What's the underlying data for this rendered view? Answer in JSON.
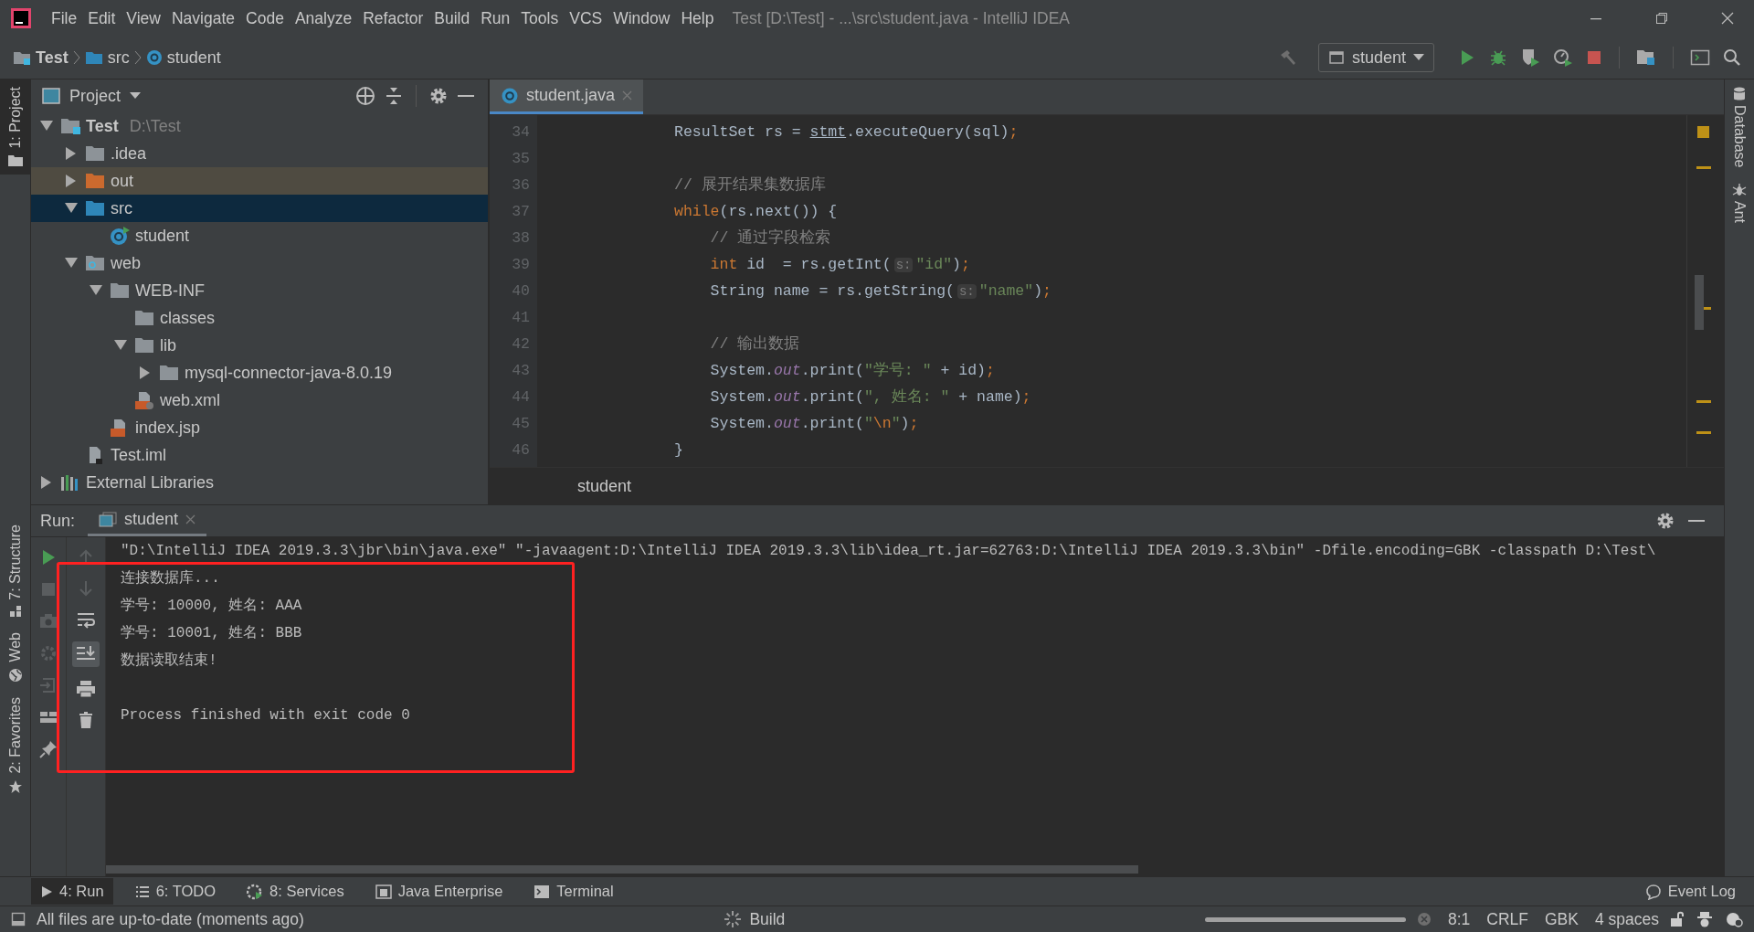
{
  "window": {
    "title": "Test [D:\\Test] - ...\\src\\student.java - IntelliJ IDEA"
  },
  "menu": [
    "File",
    "Edit",
    "View",
    "Navigate",
    "Code",
    "Analyze",
    "Refactor",
    "Build",
    "Run",
    "Tools",
    "VCS",
    "Window",
    "Help"
  ],
  "breadcrumbs": [
    {
      "label": "Test",
      "kind": "project"
    },
    {
      "label": "src",
      "kind": "source"
    },
    {
      "label": "student",
      "kind": "class"
    }
  ],
  "run_config": {
    "label": "student"
  },
  "left_tabs_top": [
    {
      "label": "1: Project",
      "selected": true
    }
  ],
  "left_tabs_bottom": [
    {
      "label": "7: Structure",
      "selected": false,
      "kind": "structure"
    },
    {
      "label": "Web",
      "selected": false,
      "kind": "web"
    },
    {
      "label": "2: Favorites",
      "selected": false,
      "kind": "favorites"
    }
  ],
  "project_panel": {
    "title": "Project",
    "tree": [
      {
        "label": "Test",
        "path": "D:\\Test",
        "kind": "project",
        "expanded": true,
        "selected": false,
        "children": [
          {
            "label": ".idea",
            "kind": "folder",
            "expanded": false,
            "selected": false
          },
          {
            "label": "out",
            "kind": "excluded",
            "expanded": false,
            "selected": false
          },
          {
            "label": "src",
            "kind": "source",
            "expanded": true,
            "selected": true,
            "children": [
              {
                "label": "student",
                "kind": "class",
                "selected": false
              }
            ]
          },
          {
            "label": "web",
            "kind": "web",
            "expanded": true,
            "selected": false,
            "children": [
              {
                "label": "WEB-INF",
                "kind": "folder",
                "expanded": true,
                "selected": false,
                "children": [
                  {
                    "label": "classes",
                    "kind": "folder",
                    "selected": false
                  },
                  {
                    "label": "lib",
                    "kind": "folder",
                    "expanded": true,
                    "selected": false,
                    "children": [
                      {
                        "label": "mysql-connector-java-8.0.19",
                        "kind": "folder",
                        "expanded": false,
                        "selected": false
                      }
                    ]
                  },
                  {
                    "label": "web.xml",
                    "kind": "xml",
                    "selected": false
                  }
                ]
              },
              {
                "label": "index.jsp",
                "kind": "jsp",
                "selected": false
              }
            ]
          },
          {
            "label": "Test.iml",
            "kind": "iml",
            "selected": false
          }
        ]
      },
      {
        "label": "External Libraries",
        "kind": "libraries",
        "expanded": false,
        "selected": false
      }
    ]
  },
  "editor": {
    "tabs": [
      {
        "label": "student.java",
        "selected": true
      }
    ],
    "lines": [
      {
        "number": "34",
        "tokens": [
          {
            "kind": "plain",
            "text": "ResultSet rs = "
          },
          {
            "kind": "underline",
            "text": "stmt"
          },
          {
            "kind": "plain",
            "text": ".executeQuery(sql)"
          },
          {
            "kind": "keyword",
            "text": ";"
          }
        ]
      },
      {
        "number": "35"
      },
      {
        "number": "36",
        "tokens": [
          {
            "kind": "comment",
            "text": "// 展开结果集数据库"
          }
        ]
      },
      {
        "number": "37",
        "tokens": [
          {
            "kind": "keyword",
            "text": "while"
          },
          {
            "kind": "plain",
            "text": "(rs.next()) {"
          }
        ]
      },
      {
        "number": "38",
        "tokens": [
          {
            "kind": "comment",
            "text": "    // 通过字段检索"
          }
        ]
      },
      {
        "number": "39",
        "tokens": [
          {
            "kind": "keyword",
            "text": "    int"
          },
          {
            "kind": "plain",
            "text": " id  = rs.getInt("
          },
          {
            "kind": "hint",
            "text": "s:"
          },
          {
            "kind": "string",
            "text": "\"id\""
          },
          {
            "kind": "plain",
            "text": ")"
          },
          {
            "kind": "keyword",
            "text": ";"
          }
        ]
      },
      {
        "number": "40",
        "tokens": [
          {
            "kind": "plain",
            "text": "    String name = rs.getString("
          },
          {
            "kind": "hint",
            "text": "s:"
          },
          {
            "kind": "string",
            "text": "\"name\""
          },
          {
            "kind": "plain",
            "text": ")"
          },
          {
            "kind": "keyword",
            "text": ";"
          }
        ]
      },
      {
        "number": "41"
      },
      {
        "number": "42",
        "tokens": [
          {
            "kind": "comment",
            "text": "    // 输出数据"
          }
        ]
      },
      {
        "number": "43",
        "tokens": [
          {
            "kind": "plain",
            "text": "    System."
          },
          {
            "kind": "field",
            "text": "out"
          },
          {
            "kind": "plain",
            "text": ".print("
          },
          {
            "kind": "string",
            "text": "\"学号: \""
          },
          {
            "kind": "plain",
            "text": " + id)"
          },
          {
            "kind": "keyword",
            "text": ";"
          }
        ]
      },
      {
        "number": "44",
        "tokens": [
          {
            "kind": "plain",
            "text": "    System."
          },
          {
            "kind": "field",
            "text": "out"
          },
          {
            "kind": "plain",
            "text": ".print("
          },
          {
            "kind": "string",
            "text": "\", 姓名: \""
          },
          {
            "kind": "plain",
            "text": " + name)"
          },
          {
            "kind": "keyword",
            "text": ";"
          }
        ]
      },
      {
        "number": "45",
        "tokens": [
          {
            "kind": "plain",
            "text": "    System."
          },
          {
            "kind": "field",
            "text": "out"
          },
          {
            "kind": "plain",
            "text": ".print("
          },
          {
            "kind": "string",
            "text": "\""
          },
          {
            "kind": "escape",
            "text": "\\n"
          },
          {
            "kind": "string",
            "text": "\""
          },
          {
            "kind": "plain",
            "text": ")"
          },
          {
            "kind": "keyword",
            "text": ";"
          }
        ]
      },
      {
        "number": "46",
        "tokens": [
          {
            "kind": "plain",
            "text": "}"
          }
        ]
      }
    ],
    "breadcrumb": "student"
  },
  "right_tabs": [
    {
      "label": "Database",
      "kind": "database"
    },
    {
      "label": "Ant",
      "kind": "ant"
    }
  ],
  "run_panel": {
    "label": "Run:",
    "tabs": [
      {
        "label": "student",
        "selected": true
      }
    ],
    "console": [
      {
        "kind": "command",
        "text": "\"D:\\IntelliJ IDEA 2019.3.3\\jbr\\bin\\java.exe\" \"-javaagent:D:\\IntelliJ IDEA 2019.3.3\\lib\\idea_rt.jar=62763:D:\\IntelliJ IDEA 2019.3.3\\bin\" -Dfile.encoding=GBK -classpath D:\\Test\\"
      },
      {
        "kind": "output",
        "text": "连接数据库..."
      },
      {
        "kind": "output",
        "text": "学号: 10000, 姓名: AAA"
      },
      {
        "kind": "output",
        "text": "学号: 10001, 姓名: BBB"
      },
      {
        "kind": "output",
        "text": "数据读取结束!"
      },
      {
        "kind": "exit",
        "text": "Process finished with exit code 0"
      }
    ]
  },
  "tool_buttons": [
    {
      "label": "4: Run",
      "selected": true,
      "kind": "run"
    },
    {
      "label": "6: TODO",
      "selected": false,
      "kind": "todo"
    },
    {
      "label": "8: Services",
      "selected": false,
      "kind": "services"
    },
    {
      "label": "Java Enterprise",
      "selected": false,
      "kind": "enterprise"
    },
    {
      "label": "Terminal",
      "selected": false,
      "kind": "terminal"
    }
  ],
  "event_log": "Event Log",
  "status_bar": {
    "message": "All files are up-to-date (moments ago)",
    "task": "Build",
    "level": 1,
    "position": "8:1",
    "line_separator": "CRLF",
    "encoding": "GBK",
    "indent": "4 spaces"
  }
}
